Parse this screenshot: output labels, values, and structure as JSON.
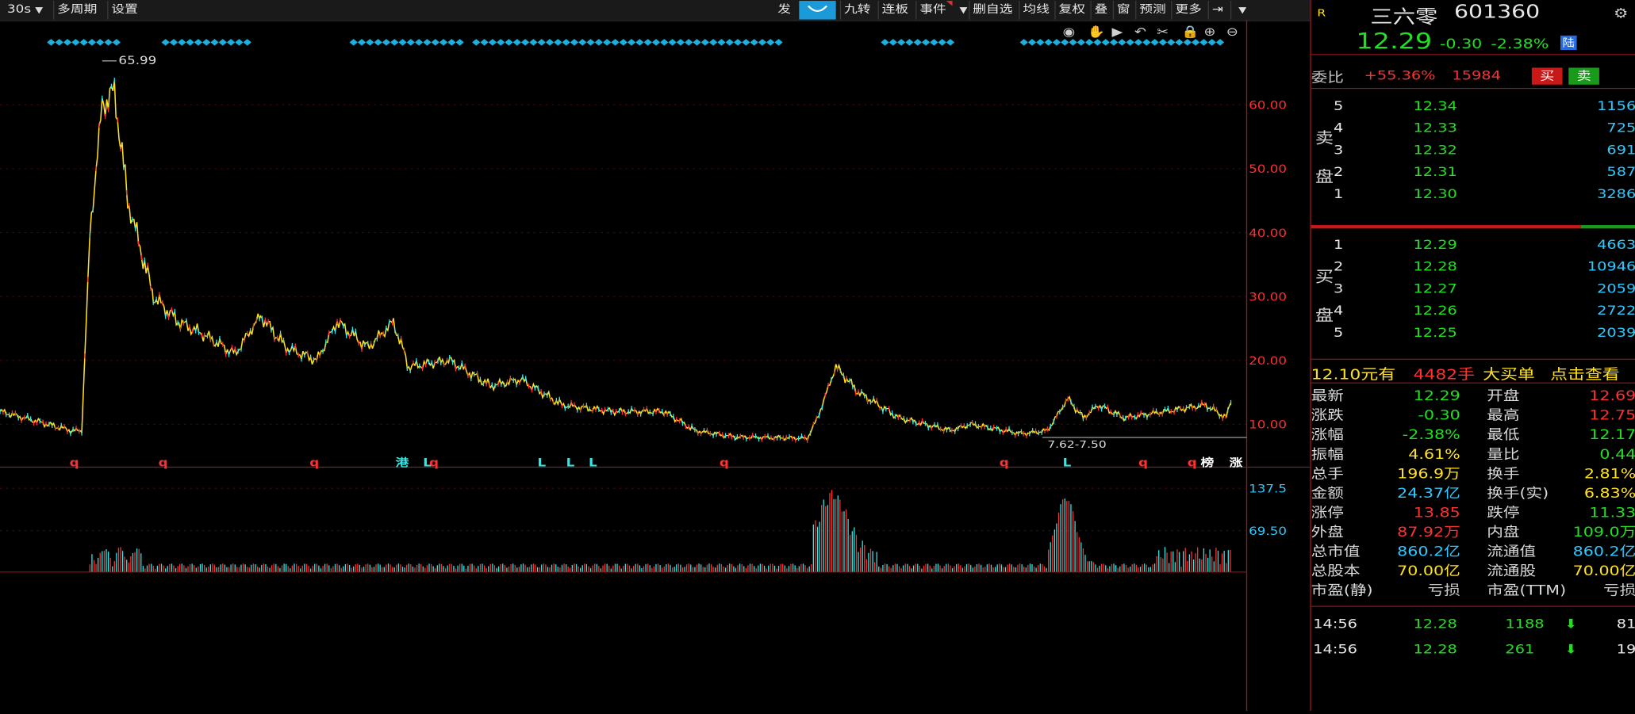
{
  "toolbar": {
    "period": "30s",
    "multi_period": "多周期",
    "settings": "设置",
    "fa": "发",
    "nine_turn": "九转",
    "lianban": "连板",
    "events": "事件",
    "delete_watch": "删自选",
    "ma_line": "均线",
    "restore_rights": "复权",
    "overlay": "叠",
    "window": "窗",
    "predict": "预测",
    "more": "更多"
  },
  "stock": {
    "badge": "R",
    "name": "三六零",
    "code": "601360",
    "price": "12.29",
    "change": "-0.30",
    "change_pct": "-2.38%",
    "market_badge": "陆"
  },
  "weibi": {
    "label": "委比",
    "pct": "+55.36%",
    "diff": "15984",
    "buy": "买",
    "sell": "卖"
  },
  "sell_label": [
    "卖",
    "盘"
  ],
  "buy_label": [
    "买",
    "盘"
  ],
  "asks": [
    {
      "lvl": "5",
      "price": "12.34",
      "vol": "1156"
    },
    {
      "lvl": "4",
      "price": "12.33",
      "vol": "725"
    },
    {
      "lvl": "3",
      "price": "12.32",
      "vol": "691"
    },
    {
      "lvl": "2",
      "price": "12.31",
      "vol": "587"
    },
    {
      "lvl": "1",
      "price": "12.30",
      "vol": "3286"
    }
  ],
  "bids": [
    {
      "lvl": "1",
      "price": "12.29",
      "vol": "4663"
    },
    {
      "lvl": "2",
      "price": "12.28",
      "vol": "10946"
    },
    {
      "lvl": "3",
      "price": "12.27",
      "vol": "2059"
    },
    {
      "lvl": "4",
      "price": "12.26",
      "vol": "2722"
    },
    {
      "lvl": "5",
      "price": "12.25",
      "vol": "2039"
    }
  ],
  "big_order": {
    "price": "12.10元有",
    "qty": "4482手",
    "label": "大买单",
    "link": "点击查看"
  },
  "stats": [
    {
      "l": "最新",
      "v": "12.29",
      "vc": "green",
      "l2": "开盘",
      "v2": "12.69",
      "vc2": "red"
    },
    {
      "l": "涨跌",
      "v": "-0.30",
      "vc": "green",
      "l2": "最高",
      "v2": "12.75",
      "vc2": "red"
    },
    {
      "l": "涨幅",
      "v": "-2.38%",
      "vc": "green",
      "l2": "最低",
      "v2": "12.17",
      "vc2": "green"
    },
    {
      "l": "振幅",
      "v": "4.61%",
      "vc": "yellow",
      "l2": "量比",
      "v2": "0.44",
      "vc2": "green"
    },
    {
      "l": "总手",
      "v": "196.9万",
      "vc": "yellow",
      "l2": "换手",
      "v2": "2.81%",
      "vc2": "yellow"
    },
    {
      "l": "金额",
      "v": "24.37亿",
      "vc": "cyan",
      "l2": "换手(实)",
      "v2": "6.83%",
      "vc2": "yellow"
    },
    {
      "l": "涨停",
      "v": "13.85",
      "vc": "red",
      "l2": "跌停",
      "v2": "11.33",
      "vc2": "green"
    },
    {
      "l": "外盘",
      "v": "87.92万",
      "vc": "red",
      "l2": "内盘",
      "v2": "109.0万",
      "vc2": "green"
    },
    {
      "l": "总市值",
      "v": "860.2亿",
      "vc": "cyan",
      "l2": "流通值",
      "v2": "860.2亿",
      "vc2": "cyan"
    },
    {
      "l": "总股本",
      "v": "70.00亿",
      "vc": "yellow",
      "l2": "流通股",
      "v2": "70.00亿",
      "vc2": "yellow"
    },
    {
      "l": "市盈(静)",
      "v": "亏损",
      "vc": "gray",
      "l2": "市盈(TTM)",
      "v2": "亏损",
      "vc2": "gray"
    }
  ],
  "ticks": [
    {
      "time": "14:56",
      "price": "12.28",
      "vol": "1188",
      "n": "81"
    },
    {
      "time": "14:56",
      "price": "12.28",
      "vol": "261",
      "n": "19"
    }
  ],
  "chart": {
    "y_labels": [
      "60.00",
      "50.00",
      "40.00",
      "30.00",
      "20.00",
      "10.00"
    ],
    "high_label": "65.99",
    "low_label": "7.62-7.50",
    "vol_labels": [
      "137.5",
      "69.50"
    ],
    "markers": [
      "q",
      "q",
      "q",
      "港",
      "L",
      "q",
      "L",
      "L",
      "L",
      "q",
      "q",
      "L",
      "q",
      "q",
      "榜",
      "涨"
    ]
  },
  "colors": {
    "up": "#ff3030",
    "down": "#30e8e8",
    "price_line": "#ffe020",
    "axis": "#a01818"
  }
}
